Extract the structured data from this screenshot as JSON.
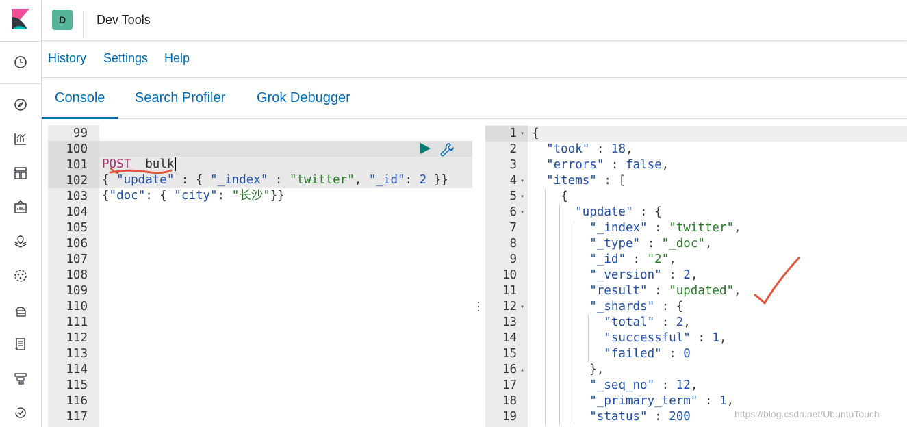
{
  "app": {
    "title": "Dev Tools",
    "space_initial": "D"
  },
  "submenu": {
    "history": "History",
    "settings": "Settings",
    "help": "Help"
  },
  "tabs": [
    {
      "label": "Console",
      "selected": true
    },
    {
      "label": "Search Profiler",
      "selected": false
    },
    {
      "label": "Grok Debugger",
      "selected": false
    }
  ],
  "nav_icons": [
    "clock-icon",
    "compass-icon",
    "visualize-icon",
    "dashboard-icon",
    "canvas-icon",
    "maps-icon",
    "ml-icon",
    "infrastructure-icon",
    "logs-icon",
    "apm-icon",
    "uptime-icon"
  ],
  "request": {
    "line_numbers": [
      "99",
      "100",
      "101",
      "102",
      "103",
      "104",
      "105",
      "106",
      "107",
      "108",
      "109",
      "110",
      "111",
      "112",
      "113",
      "114",
      "115",
      "116",
      "117"
    ],
    "method": "POST",
    "endpoint": "_bulk",
    "line101": {
      "open": "{ ",
      "key_update": "\"update\"",
      "sep1": " : { ",
      "key_index": "\"_index\"",
      "sep2": " : ",
      "val_index": "\"twitter\"",
      "sep3": ", ",
      "key_id": "\"_id\"",
      "sep4": ": ",
      "val_id": "2",
      "close": " }}"
    },
    "line102": {
      "open": "{",
      "key_doc": "\"doc\"",
      "sep1": ": { ",
      "key_city": "\"city\"",
      "sep2": ": ",
      "val_city": "\"长沙\"",
      "close": "}}"
    }
  },
  "response": {
    "line_numbers": [
      "1",
      "2",
      "3",
      "4",
      "5",
      "6",
      "7",
      "8",
      "9",
      "10",
      "11",
      "12",
      "13",
      "14",
      "15",
      "16",
      "17",
      "18",
      "19"
    ],
    "lines": [
      {
        "indent": "",
        "parts": [
          [
            "p",
            "{"
          ]
        ]
      },
      {
        "indent": "  ",
        "parts": [
          [
            "k",
            "\"took\""
          ],
          [
            "p",
            " : "
          ],
          [
            "n",
            "18"
          ],
          [
            "p",
            ","
          ]
        ]
      },
      {
        "indent": "  ",
        "parts": [
          [
            "k",
            "\"errors\""
          ],
          [
            "p",
            " : "
          ],
          [
            "n",
            "false"
          ],
          [
            "p",
            ","
          ]
        ]
      },
      {
        "indent": "  ",
        "parts": [
          [
            "k",
            "\"items\""
          ],
          [
            "p",
            " : ["
          ]
        ]
      },
      {
        "indent": "    ",
        "parts": [
          [
            "p",
            "{"
          ]
        ]
      },
      {
        "indent": "      ",
        "parts": [
          [
            "k",
            "\"update\""
          ],
          [
            "p",
            " : {"
          ]
        ]
      },
      {
        "indent": "        ",
        "parts": [
          [
            "k",
            "\"_index\""
          ],
          [
            "p",
            " : "
          ],
          [
            "s",
            "\"twitter\""
          ],
          [
            "p",
            ","
          ]
        ]
      },
      {
        "indent": "        ",
        "parts": [
          [
            "k",
            "\"_type\""
          ],
          [
            "p",
            " : "
          ],
          [
            "s",
            "\"_doc\""
          ],
          [
            "p",
            ","
          ]
        ]
      },
      {
        "indent": "        ",
        "parts": [
          [
            "k",
            "\"_id\""
          ],
          [
            "p",
            " : "
          ],
          [
            "s",
            "\"2\""
          ],
          [
            "p",
            ","
          ]
        ]
      },
      {
        "indent": "        ",
        "parts": [
          [
            "k",
            "\"_version\""
          ],
          [
            "p",
            " : "
          ],
          [
            "n",
            "2"
          ],
          [
            "p",
            ","
          ]
        ]
      },
      {
        "indent": "        ",
        "parts": [
          [
            "k",
            "\"result\""
          ],
          [
            "p",
            " : "
          ],
          [
            "s",
            "\"updated\""
          ],
          [
            "p",
            ","
          ]
        ]
      },
      {
        "indent": "        ",
        "parts": [
          [
            "k",
            "\"_shards\""
          ],
          [
            "p",
            " : {"
          ]
        ]
      },
      {
        "indent": "          ",
        "parts": [
          [
            "k",
            "\"total\""
          ],
          [
            "p",
            " : "
          ],
          [
            "n",
            "2"
          ],
          [
            "p",
            ","
          ]
        ]
      },
      {
        "indent": "          ",
        "parts": [
          [
            "k",
            "\"successful\""
          ],
          [
            "p",
            " : "
          ],
          [
            "n",
            "1"
          ],
          [
            "p",
            ","
          ]
        ]
      },
      {
        "indent": "          ",
        "parts": [
          [
            "k",
            "\"failed\""
          ],
          [
            "p",
            " : "
          ],
          [
            "n",
            "0"
          ]
        ]
      },
      {
        "indent": "        ",
        "parts": [
          [
            "p",
            "},"
          ]
        ]
      },
      {
        "indent": "        ",
        "parts": [
          [
            "k",
            "\"_seq_no\""
          ],
          [
            "p",
            " : "
          ],
          [
            "n",
            "12"
          ],
          [
            "p",
            ","
          ]
        ]
      },
      {
        "indent": "        ",
        "parts": [
          [
            "k",
            "\"_primary_term\""
          ],
          [
            "p",
            " : "
          ],
          [
            "n",
            "1"
          ],
          [
            "p",
            ","
          ]
        ]
      },
      {
        "indent": "        ",
        "parts": [
          [
            "k",
            "\"status\""
          ],
          [
            "p",
            " : "
          ],
          [
            "n",
            "200"
          ]
        ]
      }
    ]
  },
  "watermark": "https://blog.csdn.net/UbuntuTouch",
  "colors": {
    "accent": "#006bb4",
    "avatar": "#54b399",
    "run": "#017d73",
    "annotation": "#e0553a"
  }
}
